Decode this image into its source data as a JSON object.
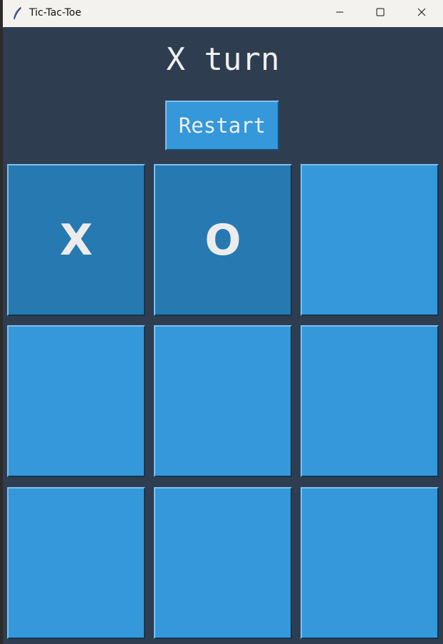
{
  "window": {
    "title": "Tic-Tac-Toe",
    "icon": "feather-icon",
    "controls": [
      "minimize-icon",
      "maximize-icon",
      "close-icon"
    ]
  },
  "status_text": "X turn",
  "restart_label": "Restart",
  "board": [
    [
      "X",
      "O",
      ""
    ],
    [
      "",
      "",
      ""
    ],
    [
      "",
      "",
      ""
    ]
  ],
  "colors": {
    "background": "#2e3e50",
    "cell": "#3498db",
    "cell_filled": "#2779b2",
    "text": "#f0f0f0"
  }
}
